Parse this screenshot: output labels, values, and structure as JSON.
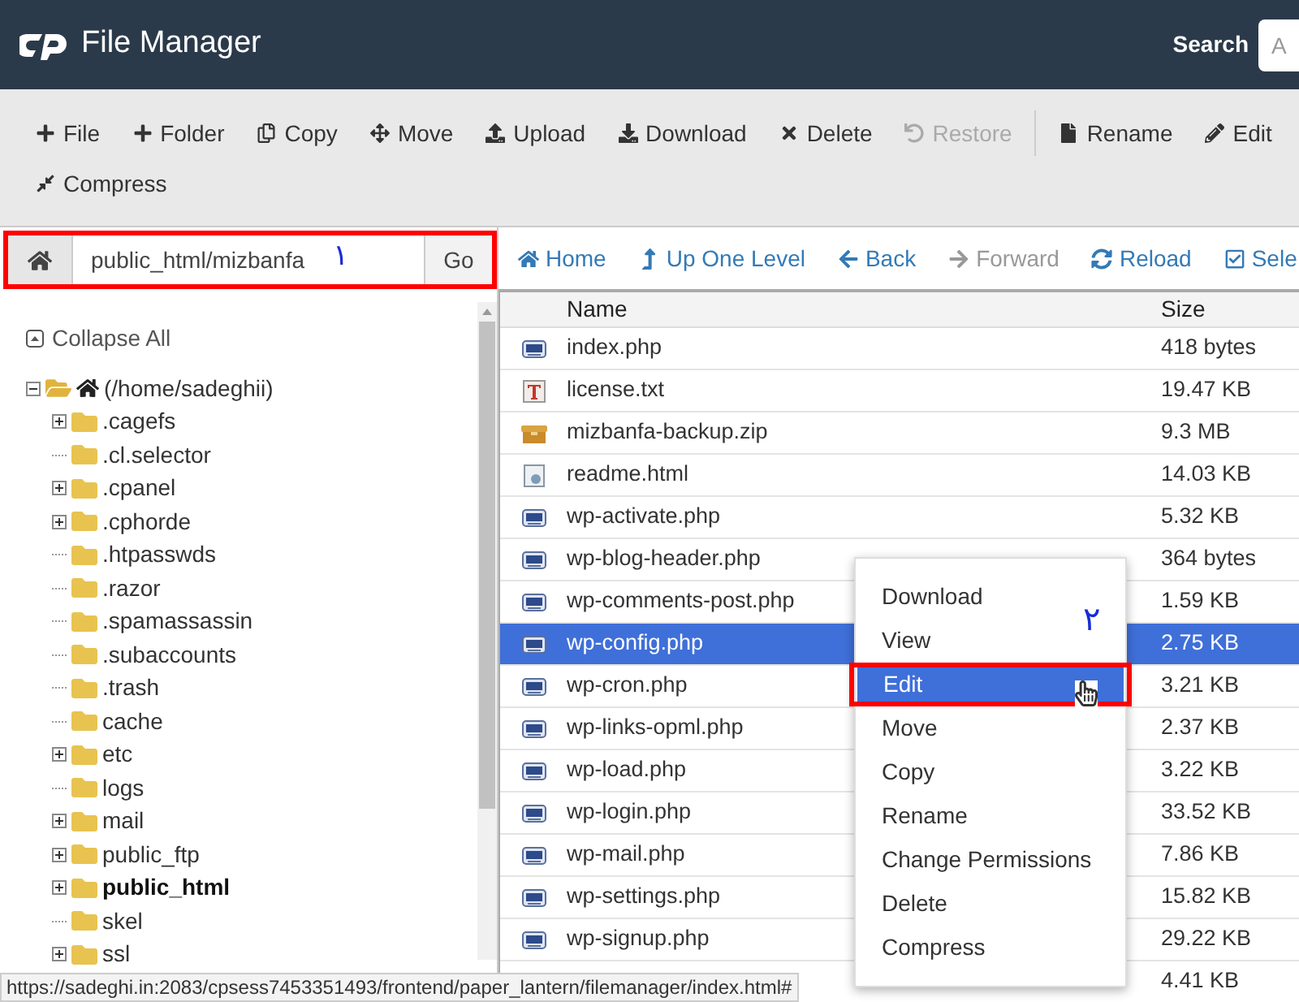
{
  "header": {
    "title": "File Manager",
    "search_label": "Search",
    "search_placeholder": "A"
  },
  "toolbar": [
    {
      "kind": "button",
      "label": "File",
      "disabled": false
    },
    {
      "kind": "button",
      "label": "Folder",
      "disabled": false
    },
    {
      "kind": "button",
      "label": "Copy",
      "disabled": false
    },
    {
      "kind": "button",
      "label": "Move",
      "disabled": false
    },
    {
      "kind": "button",
      "label": "Upload",
      "disabled": false
    },
    {
      "kind": "button",
      "label": "Download",
      "disabled": false
    },
    {
      "kind": "button",
      "label": "Delete",
      "disabled": false
    },
    {
      "kind": "button",
      "label": "Restore",
      "disabled": true
    },
    {
      "kind": "separator"
    },
    {
      "kind": "button",
      "label": "Rename",
      "disabled": false
    },
    {
      "kind": "button",
      "label": "Edit",
      "disabled": false
    },
    {
      "kind": "button",
      "label": "Compress",
      "disabled": false
    }
  ],
  "path_bar": {
    "value": "public_html/mizbanfa",
    "button": "Go",
    "annotation": "١"
  },
  "tree": {
    "collapse_all": "Collapse All",
    "root": {
      "label": "(/home/sadeghii)",
      "expanded": true,
      "children": [
        {
          "label": ".cagefs",
          "expandable": true,
          "current": false
        },
        {
          "label": ".cl.selector",
          "expandable": false,
          "current": false
        },
        {
          "label": ".cpanel",
          "expandable": true,
          "current": false
        },
        {
          "label": ".cphorde",
          "expandable": true,
          "current": false
        },
        {
          "label": ".htpasswds",
          "expandable": false,
          "current": false
        },
        {
          "label": ".razor",
          "expandable": false,
          "current": false
        },
        {
          "label": ".spamassassin",
          "expandable": false,
          "current": false
        },
        {
          "label": ".subaccounts",
          "expandable": false,
          "current": false
        },
        {
          "label": ".trash",
          "expandable": false,
          "current": false
        },
        {
          "label": "cache",
          "expandable": false,
          "current": false
        },
        {
          "label": "etc",
          "expandable": true,
          "current": false
        },
        {
          "label": "logs",
          "expandable": false,
          "current": false
        },
        {
          "label": "mail",
          "expandable": true,
          "current": false
        },
        {
          "label": "public_ftp",
          "expandable": true,
          "current": false
        },
        {
          "label": "public_html",
          "expandable": true,
          "current": true
        },
        {
          "label": "skel",
          "expandable": false,
          "current": false
        },
        {
          "label": "ssl",
          "expandable": true,
          "current": false
        }
      ]
    }
  },
  "nav": [
    {
      "label": "Home",
      "disabled": false
    },
    {
      "label": "Up One Level",
      "disabled": false
    },
    {
      "label": "Back",
      "disabled": false
    },
    {
      "label": "Forward",
      "disabled": true
    },
    {
      "label": "Reload",
      "disabled": false
    },
    {
      "label": "Sele",
      "disabled": false
    }
  ],
  "table": {
    "columns": [
      "Name",
      "Size"
    ],
    "rows": [
      {
        "kind": "php",
        "name": "index.php",
        "size": "418 bytes",
        "selected": false
      },
      {
        "kind": "text",
        "name": "license.txt",
        "size": "19.47 KB",
        "selected": false
      },
      {
        "kind": "zip",
        "name": "mizbanfa-backup.zip",
        "size": "9.3 MB",
        "selected": false
      },
      {
        "kind": "html",
        "name": "readme.html",
        "size": "14.03 KB",
        "selected": false
      },
      {
        "kind": "php",
        "name": "wp-activate.php",
        "size": "5.32 KB",
        "selected": false
      },
      {
        "kind": "php",
        "name": "wp-blog-header.php",
        "size": "364 bytes",
        "selected": false
      },
      {
        "kind": "php",
        "name": "wp-comments-post.php",
        "size": "1.59 KB",
        "selected": false
      },
      {
        "kind": "php",
        "name": "wp-config.php",
        "size": "2.75 KB",
        "selected": true
      },
      {
        "kind": "php",
        "name": "wp-cron.php",
        "size": "3.21 KB",
        "selected": false
      },
      {
        "kind": "php",
        "name": "wp-links-opml.php",
        "size": "2.37 KB",
        "selected": false
      },
      {
        "kind": "php",
        "name": "wp-load.php",
        "size": "3.22 KB",
        "selected": false
      },
      {
        "kind": "php",
        "name": "wp-login.php",
        "size": "33.52 KB",
        "selected": false
      },
      {
        "kind": "php",
        "name": "wp-mail.php",
        "size": "7.86 KB",
        "selected": false
      },
      {
        "kind": "php",
        "name": "wp-settings.php",
        "size": "15.82 KB",
        "selected": false
      },
      {
        "kind": "php",
        "name": "wp-signup.php",
        "size": "29.22 KB",
        "selected": false
      },
      {
        "size": "4.41 KB",
        "selected": false
      }
    ]
  },
  "context_menu": {
    "annotation": "٢",
    "items": [
      {
        "label": "Download",
        "selected": false
      },
      {
        "label": "View",
        "selected": false
      },
      {
        "label": "Edit",
        "selected": true
      },
      {
        "label": "Move",
        "selected": false
      },
      {
        "label": "Copy",
        "selected": false
      },
      {
        "label": "Rename",
        "selected": false
      },
      {
        "label": "Change Permissions",
        "selected": false
      },
      {
        "label": "Delete",
        "selected": false
      },
      {
        "label": "Compress",
        "selected": false
      }
    ]
  },
  "status_bar": "https://sadeghi.in:2083/cpsess7453351493/frontend/paper_lantern/filemanager/index.html#"
}
